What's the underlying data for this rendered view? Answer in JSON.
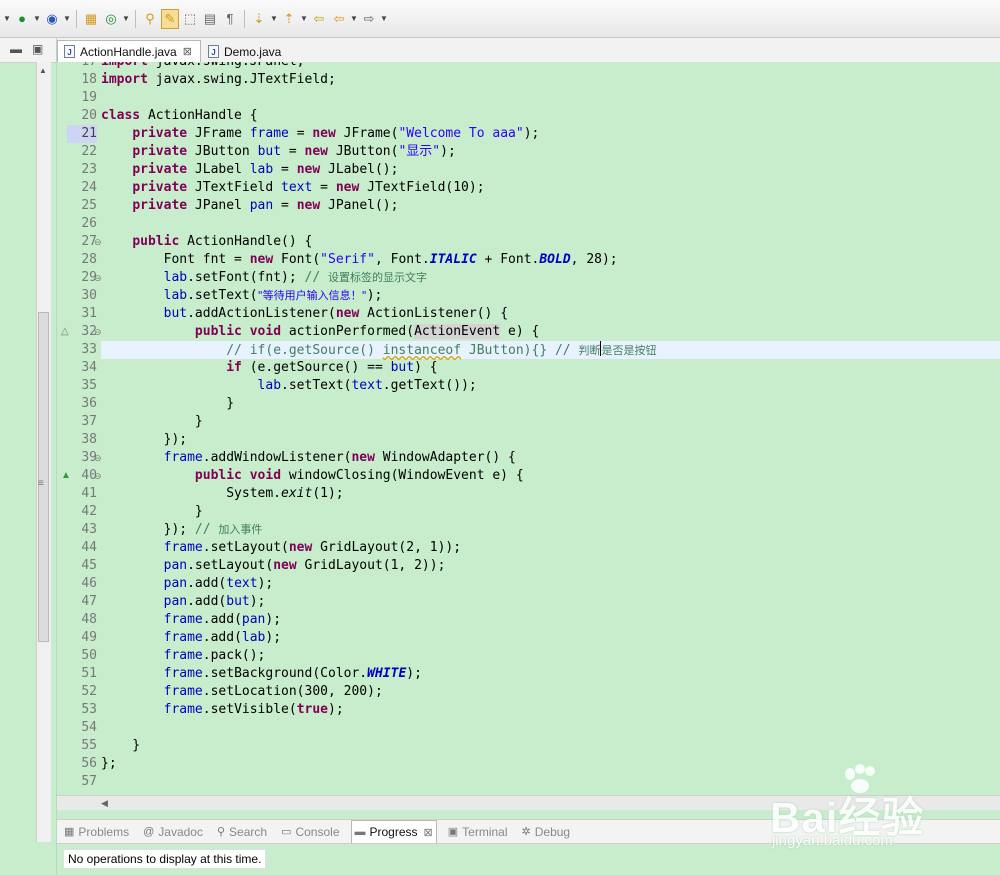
{
  "toolbar": {
    "icons": [
      "debug-icon",
      "run-icon",
      "external-tools-icon",
      "new-java-package-icon",
      "open-type-icon",
      "toggle-mark-occurrences-icon",
      "toggle-highlight-icon",
      "block-selection-icon",
      "show-whitespace-icon",
      "next-annotation-icon",
      "previous-annotation-icon",
      "last-edit-location-icon",
      "back-icon",
      "forward-icon"
    ]
  },
  "editor": {
    "tabs": [
      {
        "label": "ActionHandle.java",
        "active": true
      },
      {
        "label": "Demo.java",
        "active": false
      }
    ],
    "first_line": 17,
    "current_line": 33,
    "lines": [
      [
        {
          "t": "kw",
          "v": "import"
        },
        {
          "t": "",
          "v": " javax.swing.JPanel;"
        }
      ],
      [
        {
          "t": "kw",
          "v": "import"
        },
        {
          "t": "",
          "v": " javax.swing.JTextField;"
        }
      ],
      [],
      [
        {
          "t": "kw",
          "v": "class"
        },
        {
          "t": "",
          "v": " ActionHandle {"
        }
      ],
      [
        {
          "t": "",
          "v": "    "
        },
        {
          "t": "kw",
          "v": "private"
        },
        {
          "t": "",
          "v": " JFrame "
        },
        {
          "t": "fld",
          "v": "frame"
        },
        {
          "t": "",
          "v": " = "
        },
        {
          "t": "kw",
          "v": "new"
        },
        {
          "t": "",
          "v": " JFrame("
        },
        {
          "t": "str",
          "v": "\"Welcome To aaa\""
        },
        {
          "t": "",
          "v": ");"
        }
      ],
      [
        {
          "t": "",
          "v": "    "
        },
        {
          "t": "kw",
          "v": "private"
        },
        {
          "t": "",
          "v": " JButton "
        },
        {
          "t": "fld",
          "v": "but"
        },
        {
          "t": "",
          "v": " = "
        },
        {
          "t": "kw",
          "v": "new"
        },
        {
          "t": "",
          "v": " JButton("
        },
        {
          "t": "str",
          "v": "\"显示\""
        },
        {
          "t": "",
          "v": ");"
        }
      ],
      [
        {
          "t": "",
          "v": "    "
        },
        {
          "t": "kw",
          "v": "private"
        },
        {
          "t": "",
          "v": " JLabel "
        },
        {
          "t": "fld",
          "v": "lab"
        },
        {
          "t": "",
          "v": " = "
        },
        {
          "t": "kw",
          "v": "new"
        },
        {
          "t": "",
          "v": " JLabel();"
        }
      ],
      [
        {
          "t": "",
          "v": "    "
        },
        {
          "t": "kw",
          "v": "private"
        },
        {
          "t": "",
          "v": " JTextField "
        },
        {
          "t": "fld",
          "v": "text"
        },
        {
          "t": "",
          "v": " = "
        },
        {
          "t": "kw",
          "v": "new"
        },
        {
          "t": "",
          "v": " JTextField(10);"
        }
      ],
      [
        {
          "t": "",
          "v": "    "
        },
        {
          "t": "kw",
          "v": "private"
        },
        {
          "t": "",
          "v": " JPanel "
        },
        {
          "t": "fld",
          "v": "pan"
        },
        {
          "t": "",
          "v": " = "
        },
        {
          "t": "kw",
          "v": "new"
        },
        {
          "t": "",
          "v": " JPanel();"
        }
      ],
      [],
      [
        {
          "t": "",
          "v": "    "
        },
        {
          "t": "kw",
          "v": "public"
        },
        {
          "t": "",
          "v": " ActionHandle() {"
        }
      ],
      [
        {
          "t": "",
          "v": "        Font fnt = "
        },
        {
          "t": "kw",
          "v": "new"
        },
        {
          "t": "",
          "v": " Font("
        },
        {
          "t": "str",
          "v": "\"Serif\""
        },
        {
          "t": "",
          "v": ", Font."
        },
        {
          "t": "cn",
          "v": "ITALIC"
        },
        {
          "t": "",
          "v": " + Font."
        },
        {
          "t": "cn",
          "v": "BOLD"
        },
        {
          "t": "",
          "v": ", 28);"
        }
      ],
      [
        {
          "t": "",
          "v": "        "
        },
        {
          "t": "fld",
          "v": "lab"
        },
        {
          "t": "",
          "v": ".setFont(fnt); "
        },
        {
          "t": "cm",
          "v": "// "
        },
        {
          "t": "cm cjk",
          "v": "设置标签的显示文字"
        }
      ],
      [
        {
          "t": "",
          "v": "        "
        },
        {
          "t": "fld",
          "v": "lab"
        },
        {
          "t": "",
          "v": ".setText("
        },
        {
          "t": "str cjk",
          "v": "\"等待用户输入信息！\""
        },
        {
          "t": "",
          "v": ");"
        }
      ],
      [
        {
          "t": "",
          "v": "        "
        },
        {
          "t": "fld",
          "v": "but"
        },
        {
          "t": "",
          "v": ".addActionListener("
        },
        {
          "t": "kw",
          "v": "new"
        },
        {
          "t": "",
          "v": " ActionListener() {"
        }
      ],
      [
        {
          "t": "",
          "v": "            "
        },
        {
          "t": "kw",
          "v": "public"
        },
        {
          "t": "",
          "v": " "
        },
        {
          "t": "kw",
          "v": "void"
        },
        {
          "t": "",
          "v": " actionPerformed("
        },
        {
          "t": "hl",
          "v": "ActionEvent"
        },
        {
          "t": "",
          "v": " e) {"
        }
      ],
      [
        {
          "t": "",
          "v": "                "
        },
        {
          "t": "cm",
          "v": "// if(e.getSource() "
        },
        {
          "t": "cm warn",
          "v": "instanceof"
        },
        {
          "t": "cm",
          "v": " JButton){} // "
        },
        {
          "t": "cm cjk",
          "v": "判断"
        },
        {
          "t": "caret",
          "v": ""
        },
        {
          "t": "cm cjk",
          "v": "是否是按钮"
        }
      ],
      [
        {
          "t": "",
          "v": "                "
        },
        {
          "t": "kw",
          "v": "if"
        },
        {
          "t": "",
          "v": " (e.getSource() == "
        },
        {
          "t": "fld",
          "v": "but"
        },
        {
          "t": "",
          "v": ") {"
        }
      ],
      [
        {
          "t": "",
          "v": "                    "
        },
        {
          "t": "fld",
          "v": "lab"
        },
        {
          "t": "",
          "v": ".setText("
        },
        {
          "t": "fld",
          "v": "text"
        },
        {
          "t": "",
          "v": ".getText());"
        }
      ],
      [
        {
          "t": "",
          "v": "                }"
        }
      ],
      [
        {
          "t": "",
          "v": "            }"
        }
      ],
      [
        {
          "t": "",
          "v": "        });"
        }
      ],
      [
        {
          "t": "",
          "v": "        "
        },
        {
          "t": "fld",
          "v": "frame"
        },
        {
          "t": "",
          "v": ".addWindowListener("
        },
        {
          "t": "kw",
          "v": "new"
        },
        {
          "t": "",
          "v": " WindowAdapter() {"
        }
      ],
      [
        {
          "t": "",
          "v": "            "
        },
        {
          "t": "kw",
          "v": "public"
        },
        {
          "t": "",
          "v": " "
        },
        {
          "t": "kw",
          "v": "void"
        },
        {
          "t": "",
          "v": " windowClosing(WindowEvent e) {"
        }
      ],
      [
        {
          "t": "",
          "v": "                System."
        },
        {
          "t": "it",
          "v": "exit"
        },
        {
          "t": "",
          "v": "(1);"
        }
      ],
      [
        {
          "t": "",
          "v": "            }"
        }
      ],
      [
        {
          "t": "",
          "v": "        }); "
        },
        {
          "t": "cm",
          "v": "// "
        },
        {
          "t": "cm cjk",
          "v": "加入事件"
        }
      ],
      [
        {
          "t": "",
          "v": "        "
        },
        {
          "t": "fld",
          "v": "frame"
        },
        {
          "t": "",
          "v": ".setLayout("
        },
        {
          "t": "kw",
          "v": "new"
        },
        {
          "t": "",
          "v": " GridLayout(2, 1));"
        }
      ],
      [
        {
          "t": "",
          "v": "        "
        },
        {
          "t": "fld",
          "v": "pan"
        },
        {
          "t": "",
          "v": ".setLayout("
        },
        {
          "t": "kw",
          "v": "new"
        },
        {
          "t": "",
          "v": " GridLayout(1, 2));"
        }
      ],
      [
        {
          "t": "",
          "v": "        "
        },
        {
          "t": "fld",
          "v": "pan"
        },
        {
          "t": "",
          "v": ".add("
        },
        {
          "t": "fld",
          "v": "text"
        },
        {
          "t": "",
          "v": ");"
        }
      ],
      [
        {
          "t": "",
          "v": "        "
        },
        {
          "t": "fld",
          "v": "pan"
        },
        {
          "t": "",
          "v": ".add("
        },
        {
          "t": "fld",
          "v": "but"
        },
        {
          "t": "",
          "v": ");"
        }
      ],
      [
        {
          "t": "",
          "v": "        "
        },
        {
          "t": "fld",
          "v": "frame"
        },
        {
          "t": "",
          "v": ".add("
        },
        {
          "t": "fld",
          "v": "pan"
        },
        {
          "t": "",
          "v": ");"
        }
      ],
      [
        {
          "t": "",
          "v": "        "
        },
        {
          "t": "fld",
          "v": "frame"
        },
        {
          "t": "",
          "v": ".add("
        },
        {
          "t": "fld",
          "v": "lab"
        },
        {
          "t": "",
          "v": ");"
        }
      ],
      [
        {
          "t": "",
          "v": "        "
        },
        {
          "t": "fld",
          "v": "frame"
        },
        {
          "t": "",
          "v": ".pack();"
        }
      ],
      [
        {
          "t": "",
          "v": "        "
        },
        {
          "t": "fld",
          "v": "frame"
        },
        {
          "t": "",
          "v": ".setBackground(Color."
        },
        {
          "t": "cn",
          "v": "WHITE"
        },
        {
          "t": "",
          "v": ");"
        }
      ],
      [
        {
          "t": "",
          "v": "        "
        },
        {
          "t": "fld",
          "v": "frame"
        },
        {
          "t": "",
          "v": ".setLocation(300, 200);"
        }
      ],
      [
        {
          "t": "",
          "v": "        "
        },
        {
          "t": "fld",
          "v": "frame"
        },
        {
          "t": "",
          "v": ".setVisible("
        },
        {
          "t": "kw",
          "v": "true"
        },
        {
          "t": "",
          "v": ");"
        }
      ],
      [],
      [
        {
          "t": "",
          "v": "    }"
        }
      ],
      [
        {
          "t": "",
          "v": "};"
        }
      ],
      []
    ],
    "fold_minus_lines": [
      27,
      29,
      32,
      39,
      40
    ],
    "override_lines": [
      {
        "line": 32,
        "symbol": "△"
      },
      {
        "line": 40,
        "symbol": "▲"
      }
    ],
    "marked_line": 21
  },
  "bottom": {
    "tabs": [
      {
        "label": "Problems",
        "icon": "problems-icon",
        "active": false
      },
      {
        "label": "Javadoc",
        "icon": "javadoc-icon",
        "active": false
      },
      {
        "label": "Search",
        "icon": "search-icon",
        "active": false
      },
      {
        "label": "Console",
        "icon": "console-icon",
        "active": false
      },
      {
        "label": "Progress",
        "icon": "progress-icon",
        "active": true
      },
      {
        "label": "Terminal",
        "icon": "terminal-icon",
        "active": false
      },
      {
        "label": "Debug",
        "icon": "debug-view-icon",
        "active": false
      }
    ],
    "progress_message": "No operations to display at this time."
  },
  "watermark": {
    "logo": "Bai经验",
    "url": "jingyan.baidu.com"
  },
  "colors": {
    "background": "#c7edcc",
    "keyword": "#7f0055",
    "field": "#0000c0",
    "string": "#2a00ff",
    "comment": "#3f7f5f"
  }
}
